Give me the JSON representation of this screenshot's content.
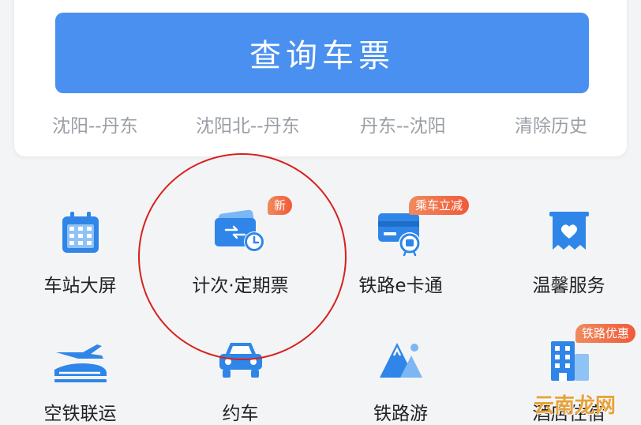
{
  "search": {
    "button_label": "查询车票"
  },
  "history": {
    "items": [
      "沈阳--丹东",
      "沈阳北--丹东",
      "丹东--沈阳"
    ],
    "clear_label": "清除历史"
  },
  "services": {
    "items": [
      {
        "label": "车站大屏",
        "icon": "station-screen-icon",
        "badge": ""
      },
      {
        "label": "计次·定期票",
        "icon": "ticket-card-clock-icon",
        "badge": "新"
      },
      {
        "label": "铁路e卡通",
        "icon": "rail-ecard-icon",
        "badge": "乘车立减"
      },
      {
        "label": "温馨服务",
        "icon": "heart-service-icon",
        "badge": ""
      },
      {
        "label": "空铁联运",
        "icon": "plane-train-icon",
        "badge": ""
      },
      {
        "label": "约车",
        "icon": "car-icon",
        "badge": ""
      },
      {
        "label": "铁路游",
        "icon": "mountain-travel-icon",
        "badge": ""
      },
      {
        "label": "酒店住宿",
        "icon": "hotel-building-icon",
        "badge": "铁路优惠"
      }
    ]
  },
  "watermark": "云南龙网",
  "colors": {
    "accent": "#4a90f0",
    "icon_blue": "#2f86e8",
    "badge": "#f06a45",
    "annotation": "#d8201c"
  }
}
